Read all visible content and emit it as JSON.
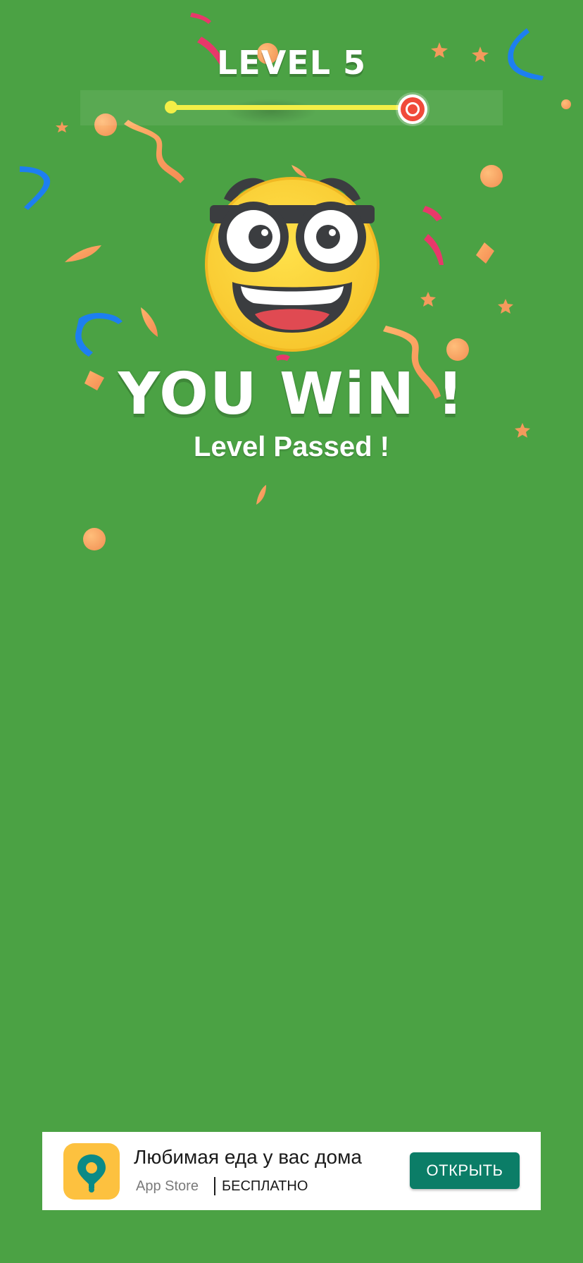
{
  "game": {
    "level_title": "LEVEL 5",
    "progress": 1.0,
    "result_title": "YOU WiN !",
    "result_subtitle": "Level Passed !",
    "emoji": "nerd-face-with-glasses"
  },
  "ad": {
    "title": "Любимая еда у вас дома",
    "store": "App Store",
    "price": "БЕСПЛАТНО",
    "button_label": "ОТКРЫТЬ",
    "icon": "location-pin-icon"
  },
  "colors": {
    "background": "#4ba244",
    "progress_track": "#f4ef47",
    "progress_knob": "#f04a3a",
    "ad_button": "#0b7d67",
    "ad_icon_bg": "#fdc13f",
    "emoji_face": "#fcd538",
    "glasses": "#3b3d40"
  }
}
